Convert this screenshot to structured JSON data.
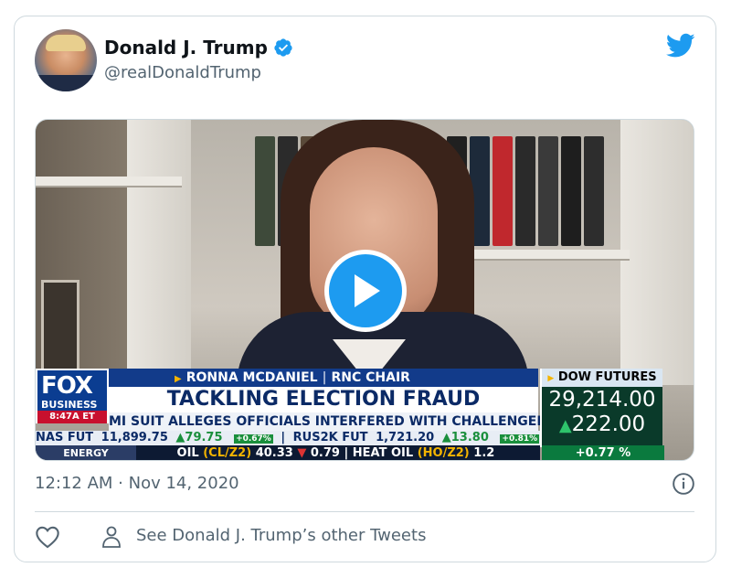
{
  "tweet": {
    "author_name": "Donald J. Trump",
    "handle": "@realDonaldTrump",
    "timestamp": "12:12 AM · Nov 14, 2020",
    "other_tweets_label": "See Donald J. Trump’s other Tweets"
  },
  "video_overlay": {
    "network_logo": "FOX",
    "network_sub": "BUSINESS",
    "clock": "8:47A ET",
    "guest_name": "RONNA MCDANIEL",
    "guest_title": "RNC CHAIR",
    "headline": "TACKLING ELECTION FRAUD",
    "subheadline": "MI SUIT ALLEGES OFFICIALS INTERFERED WITH CHALLENGERS",
    "dow_label": "DOW FUTURES",
    "dow_value": "29,214.00",
    "dow_change": "222.00",
    "dow_pct": "+0.77",
    "ticker_nas_label": "NAS FUT",
    "ticker_nas_value": "11,899.75",
    "ticker_nas_change": "79.75",
    "ticker_nas_pct": "+0.67%",
    "ticker_rus_label": "RUS2K FUT",
    "ticker_rus_value": "1,721.20",
    "ticker_rus_change": "13.80",
    "ticker_rus_pct": "+0.81%",
    "energy_label": "ENERGY",
    "oil_label": "OIL",
    "oil_code": "(CL/Z2)",
    "oil_value": "40.33",
    "oil_change": "0.79",
    "heat_label": "HEAT OIL",
    "heat_code": "(HO/Z2)",
    "heat_value": "1.2"
  },
  "colors": {
    "brand_blue": "#1d9bf0",
    "text_primary": "#0f1419",
    "text_secondary": "#536471",
    "border": "#cfd9de"
  },
  "icons": [
    "verified-badge-icon",
    "twitter-bird-icon",
    "play-icon",
    "info-icon",
    "heart-icon",
    "person-icon"
  ]
}
